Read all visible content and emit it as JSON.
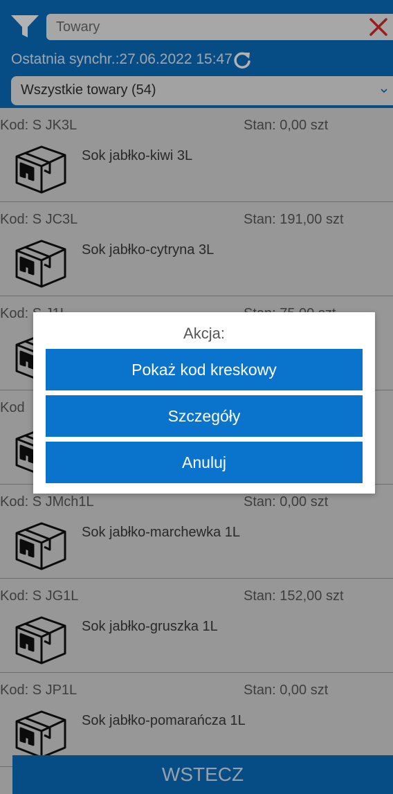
{
  "header": {
    "search_placeholder": "Towary",
    "sync_text": "Ostatnia synchr.:27.06.2022 15:47",
    "select_value": "Wszystkie towary (54)"
  },
  "list": {
    "items": [
      {
        "code": "Kod: S JK3L",
        "stan": "Stan: 0,00 szt",
        "name": "Sok jabłko-kiwi 3L"
      },
      {
        "code": "Kod: S JC3L",
        "stan": "Stan: 191,00 szt",
        "name": "Sok jabłko-cytryna 3L"
      },
      {
        "code": "Kod: S J1L",
        "stan": "Stan: 75,00 szt",
        "name": ""
      },
      {
        "code": "Kod",
        "stan": "",
        "name": ""
      },
      {
        "code": "Kod: S JMch1L",
        "stan": "Stan: 0,00 szt",
        "name": "Sok jabłko-marchewka 1L"
      },
      {
        "code": "Kod: S JG1L",
        "stan": "Stan: 152,00 szt",
        "name": "Sok jabłko-gruszka 1L"
      },
      {
        "code": "Kod: S JP1L",
        "stan": "Stan: 0,00 szt",
        "name": "Sok jabłko-pomarańcza 1L"
      }
    ]
  },
  "footer": {
    "back_label": "WSTECZ"
  },
  "dialog": {
    "title": "Akcja:",
    "buttons": [
      "Pokaż kod kreskowy",
      "Szczegóły",
      "Anuluj"
    ]
  },
  "colors": {
    "header_blue": "#0a6fbf",
    "button_blue": "#0a74cc",
    "clear_red": "#d62c2c",
    "list_bg": "#d9d9d9"
  },
  "icons": {
    "filter": "filter-icon",
    "clear": "close-icon",
    "refresh": "refresh-icon",
    "select": "chevron-down-icon",
    "item": "package-box-icon"
  }
}
